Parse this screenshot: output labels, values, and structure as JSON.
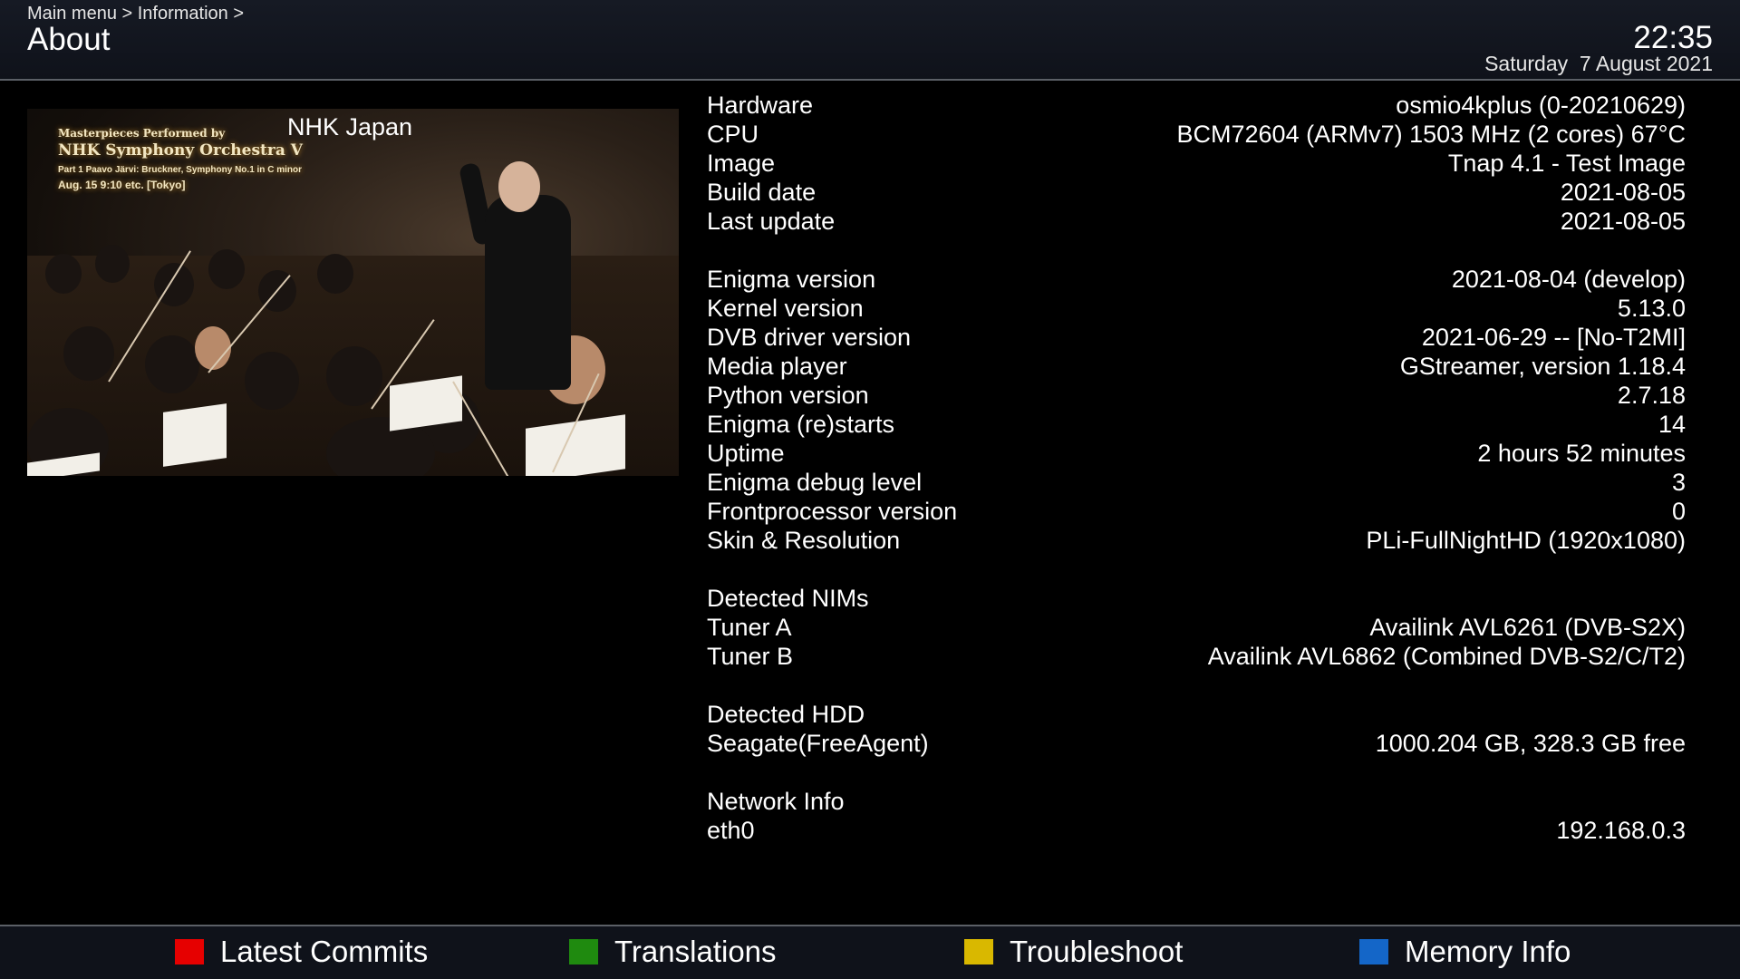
{
  "header": {
    "breadcrumb": "Main menu > Information >",
    "title": "About",
    "time": "22:35",
    "date": "Saturday  7 August 2021"
  },
  "preview": {
    "channel_name": "NHK Japan",
    "osd": {
      "line1": "Masterpieces Performed by",
      "line2": "NHK Symphony Orchestra V",
      "line3": "Part 1  Paavo Järvi: Bruckner, Symphony No.1 in C minor",
      "line4": "Aug. 15  9:10 etc. [Tokyo]"
    }
  },
  "info": [
    {
      "label": "Hardware",
      "value": "osmio4kplus (0-20210629)"
    },
    {
      "label": "CPU",
      "value": "BCM72604 (ARMv7) 1503 MHz (2 cores) 67°C"
    },
    {
      "label": "Image",
      "value": "Tnap 4.1 - Test Image"
    },
    {
      "label": "Build date",
      "value": "2021-08-05"
    },
    {
      "label": "Last update",
      "value": "2021-08-05"
    },
    {
      "label": "",
      "value": ""
    },
    {
      "label": "Enigma version",
      "value": "2021-08-04 (develop)"
    },
    {
      "label": "Kernel version",
      "value": "5.13.0"
    },
    {
      "label": "DVB driver version",
      "value": "2021-06-29 -- [No-T2MI]"
    },
    {
      "label": "Media player",
      "value": "GStreamer, version 1.18.4"
    },
    {
      "label": "Python version",
      "value": "2.7.18"
    },
    {
      "label": "Enigma (re)starts",
      "value": "14"
    },
    {
      "label": "Uptime",
      "value": "2 hours 52 minutes"
    },
    {
      "label": "Enigma debug level",
      "value": "3"
    },
    {
      "label": "Frontprocessor version",
      "value": "0"
    },
    {
      "label": "Skin & Resolution",
      "value": "PLi-FullNightHD (1920x1080)"
    },
    {
      "label": "",
      "value": ""
    },
    {
      "label": "Detected NIMs",
      "value": ""
    },
    {
      "label": "Tuner A",
      "value": "Availink AVL6261 (DVB-S2X)"
    },
    {
      "label": "Tuner B",
      "value": "Availink AVL6862 (Combined DVB-S2/C/T2)"
    },
    {
      "label": "",
      "value": ""
    },
    {
      "label": "Detected HDD",
      "value": ""
    },
    {
      "label": "Seagate(FreeAgent)",
      "value": "1000.204 GB, 328.3 GB free"
    },
    {
      "label": "",
      "value": ""
    },
    {
      "label": "Network Info",
      "value": ""
    },
    {
      "label": "eth0",
      "value": "192.168.0.3"
    }
  ],
  "footer": {
    "red_label": "Latest Commits",
    "green_label": "Translations",
    "yellow_label": "Troubleshoot",
    "blue_label": "Memory Info"
  },
  "colors": {
    "red": "#e60000",
    "green": "#1f8a0f",
    "yellow": "#d9b800",
    "blue": "#1466c8"
  }
}
